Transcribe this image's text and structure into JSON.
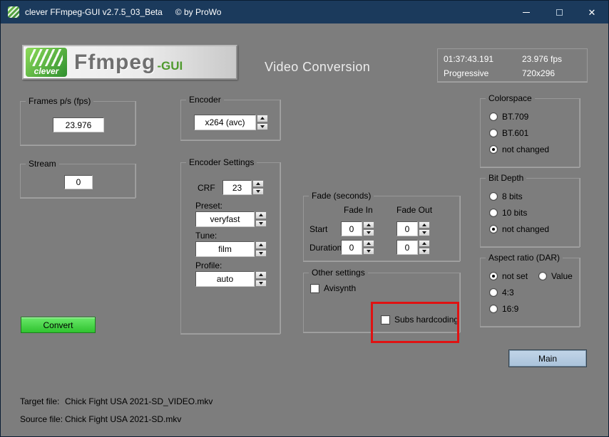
{
  "window": {
    "title": "clever FFmpeg-GUI v2.7.5_03_Beta",
    "copyright": "© by ProWo"
  },
  "titlebar_controls": {
    "close_glyph": "✕"
  },
  "logo": {
    "brand": "clever",
    "main": "Ffmpeg",
    "suffix": "-GUI"
  },
  "header": {
    "title": "Video Conversion"
  },
  "media_info": {
    "duration": "01:37:43.191",
    "framerate": "23.976 fps",
    "scan_type": "Progressive",
    "resolution": "720x296"
  },
  "fps_group": {
    "label": "Frames p/s (fps)",
    "value": "23.976"
  },
  "stream_group": {
    "label": "Stream",
    "value": "0"
  },
  "encoder_group": {
    "label": "Encoder",
    "value": "x264 (avc)"
  },
  "encoder_settings": {
    "label": "Encoder Settings",
    "crf_label": "CRF",
    "crf_value": "23",
    "preset_label": "Preset:",
    "preset_value": "veryfast",
    "tune_label": "Tune:",
    "tune_value": "film",
    "profile_label": "Profile:",
    "profile_value": "auto"
  },
  "fade": {
    "label": "Fade (seconds)",
    "fade_in_header": "Fade In",
    "fade_out_header": "Fade Out",
    "start_label": "Start",
    "duration_label": "Duration",
    "start_in": "0",
    "start_out": "0",
    "duration_in": "0",
    "duration_out": "0"
  },
  "other_settings": {
    "label": "Other settings",
    "avisynth": {
      "label": "Avisynth",
      "checked": false
    },
    "subs_hardcoding": {
      "label": "Subs hardcoding",
      "checked": false
    }
  },
  "colorspace": {
    "label": "Colorspace",
    "options": [
      {
        "label": "BT.709",
        "checked": false
      },
      {
        "label": "BT.601",
        "checked": false
      },
      {
        "label": "not changed",
        "checked": true
      }
    ]
  },
  "bit_depth": {
    "label": "Bit Depth",
    "options": [
      {
        "label": "8 bits",
        "checked": false
      },
      {
        "label": "10 bits",
        "checked": false
      },
      {
        "label": "not changed",
        "checked": true
      }
    ]
  },
  "aspect_ratio": {
    "label": "Aspect ratio (DAR)",
    "options": [
      {
        "label": "not set",
        "checked": true
      },
      {
        "label": "Value",
        "checked": false
      },
      {
        "label": "4:3",
        "checked": false
      },
      {
        "label": "16:9",
        "checked": false
      }
    ]
  },
  "buttons": {
    "convert": "Convert",
    "main": "Main"
  },
  "files": {
    "target_label": "Target file:",
    "target_value": "Chick Fight USA 2021-SD_VIDEO.mkv",
    "source_label": "Source file:",
    "source_value": "Chick Fight USA 2021-SD.mkv"
  },
  "colors": {
    "titlebar": "#1b3a5c",
    "background": "#7d7d7d",
    "convert_green": "#3fd43f",
    "main_blue": "#b3c9de",
    "highlight_red": "#e01212"
  }
}
